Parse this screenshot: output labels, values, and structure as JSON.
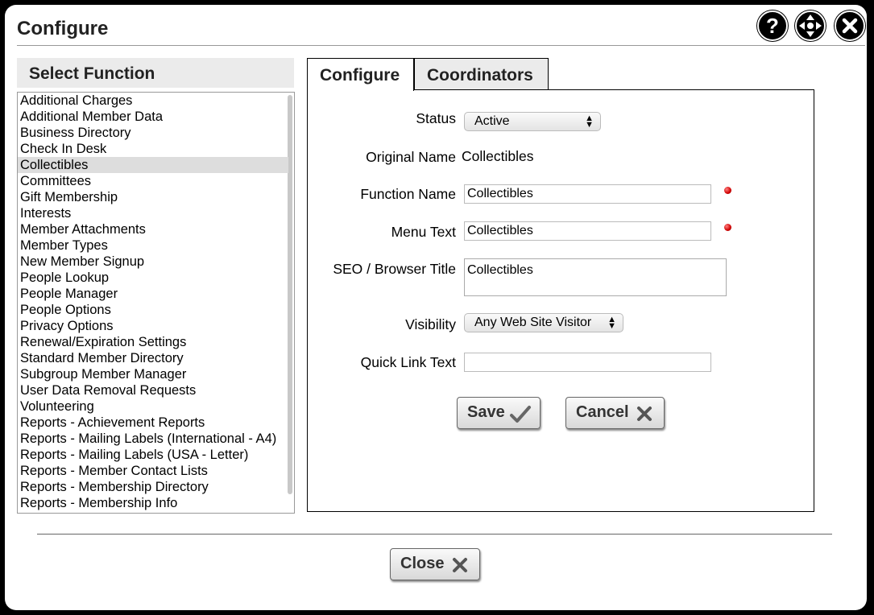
{
  "dialog": {
    "title": "Configure"
  },
  "header_icons": [
    "help-icon",
    "move-icon",
    "close-icon"
  ],
  "left": {
    "heading": "Select Function",
    "selected_index": 4,
    "items": [
      "Additional Charges",
      "Additional Member Data",
      "Business Directory",
      "Check In Desk",
      "Collectibles",
      "Committees",
      "Gift Membership",
      "Interests",
      "Member Attachments",
      "Member Types",
      "New Member Signup",
      "People Lookup",
      "People Manager",
      "People Options",
      "Privacy Options",
      "Renewal/Expiration Settings",
      "Standard Member Directory",
      "Subgroup Member Manager",
      "User Data Removal Requests",
      "Volunteering",
      "Reports - Achievement Reports",
      "Reports - Mailing Labels (International - A4)",
      "Reports - Mailing Labels (USA - Letter)",
      "Reports - Member Contact Lists",
      "Reports - Membership Directory",
      "Reports - Membership Info"
    ]
  },
  "tabs": [
    {
      "label": "Configure",
      "active": true
    },
    {
      "label": "Coordinators",
      "active": false
    }
  ],
  "form": {
    "status_label": "Status",
    "status_value": "Active",
    "original_name_label": "Original Name",
    "original_name_value": "Collectibles",
    "function_name_label": "Function Name",
    "function_name_value": "Collectibles",
    "menu_text_label": "Menu Text",
    "menu_text_value": "Collectibles",
    "seo_label": "SEO / Browser Title",
    "seo_value": "Collectibles",
    "visibility_label": "Visibility",
    "visibility_value": "Any Web Site Visitor",
    "quick_link_label": "Quick Link Text",
    "quick_link_value": ""
  },
  "buttons": {
    "save": "Save",
    "cancel": "Cancel",
    "close": "Close"
  },
  "colors": {
    "required_dot": "#d00000",
    "selected_row": "#dddddd",
    "header_bg": "#ebebeb"
  }
}
